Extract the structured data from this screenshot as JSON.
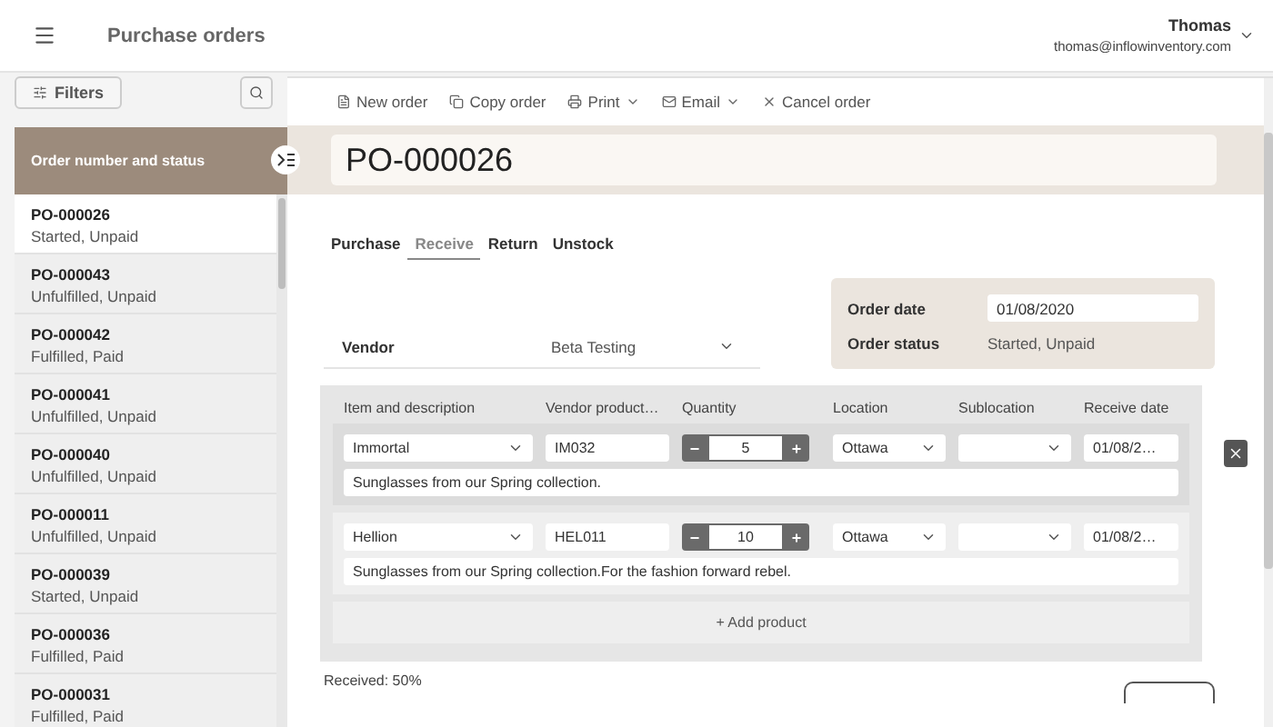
{
  "header": {
    "title": "Purchase orders",
    "user_name": "Thomas",
    "user_email": "thomas@inflowinventory.com"
  },
  "sidebar": {
    "filters_label": "Filters",
    "list_heading": "Order number and status",
    "orders": [
      {
        "number": "PO-000026",
        "status": "Started, Unpaid",
        "selected": true
      },
      {
        "number": "PO-000043",
        "status": "Unfulfilled, Unpaid",
        "selected": false
      },
      {
        "number": "PO-000042",
        "status": "Fulfilled, Paid",
        "selected": false
      },
      {
        "number": "PO-000041",
        "status": "Unfulfilled, Unpaid",
        "selected": false
      },
      {
        "number": "PO-000040",
        "status": "Unfulfilled, Unpaid",
        "selected": false
      },
      {
        "number": "PO-000011",
        "status": "Unfulfilled, Unpaid",
        "selected": false
      },
      {
        "number": "PO-000039",
        "status": "Started, Unpaid",
        "selected": false
      },
      {
        "number": "PO-000036",
        "status": "Fulfilled, Paid",
        "selected": false
      },
      {
        "number": "PO-000031",
        "status": "Fulfilled, Paid",
        "selected": false
      }
    ]
  },
  "toolbar": [
    {
      "label": "New order",
      "kind": "file",
      "dropdown": false
    },
    {
      "label": "Copy order",
      "kind": "copy",
      "dropdown": false
    },
    {
      "label": "Print",
      "kind": "print",
      "dropdown": true
    },
    {
      "label": "Email",
      "kind": "mail",
      "dropdown": true
    },
    {
      "label": "Cancel order",
      "kind": "cancel",
      "dropdown": false
    }
  ],
  "order_title": "PO-000026",
  "tabs": [
    {
      "label": "Purchase",
      "selected": false
    },
    {
      "label": "Receive",
      "selected": true
    },
    {
      "label": "Return",
      "selected": false
    },
    {
      "label": "Unstock",
      "selected": false
    }
  ],
  "vendor": {
    "label": "Vendor",
    "value": "Beta Testing"
  },
  "order_info": {
    "date_label": "Order date",
    "date": "01/08/2020",
    "status_label": "Order status",
    "status": "Started, Unpaid"
  },
  "table": {
    "columns": [
      "Item and description",
      "Vendor product…",
      "Quantity",
      "Location",
      "Sublocation",
      "Receive date"
    ],
    "minus": "−",
    "plus": "+",
    "rows": [
      {
        "item": "Immortal",
        "vendor_product": "IM032",
        "quantity": "5",
        "location": "Ottawa",
        "receive_date": "01/08/2…",
        "description": "Sunglasses from our Spring collection.",
        "selected": true
      },
      {
        "item": "Hellion",
        "vendor_product": "HEL011",
        "quantity": "10",
        "location": "Ottawa",
        "receive_date": "01/08/2…",
        "description": "Sunglasses from our Spring collection.For the fashion forward rebel.",
        "selected": false
      }
    ],
    "add_product": "+ Add product"
  },
  "received": "Received: 50%"
}
